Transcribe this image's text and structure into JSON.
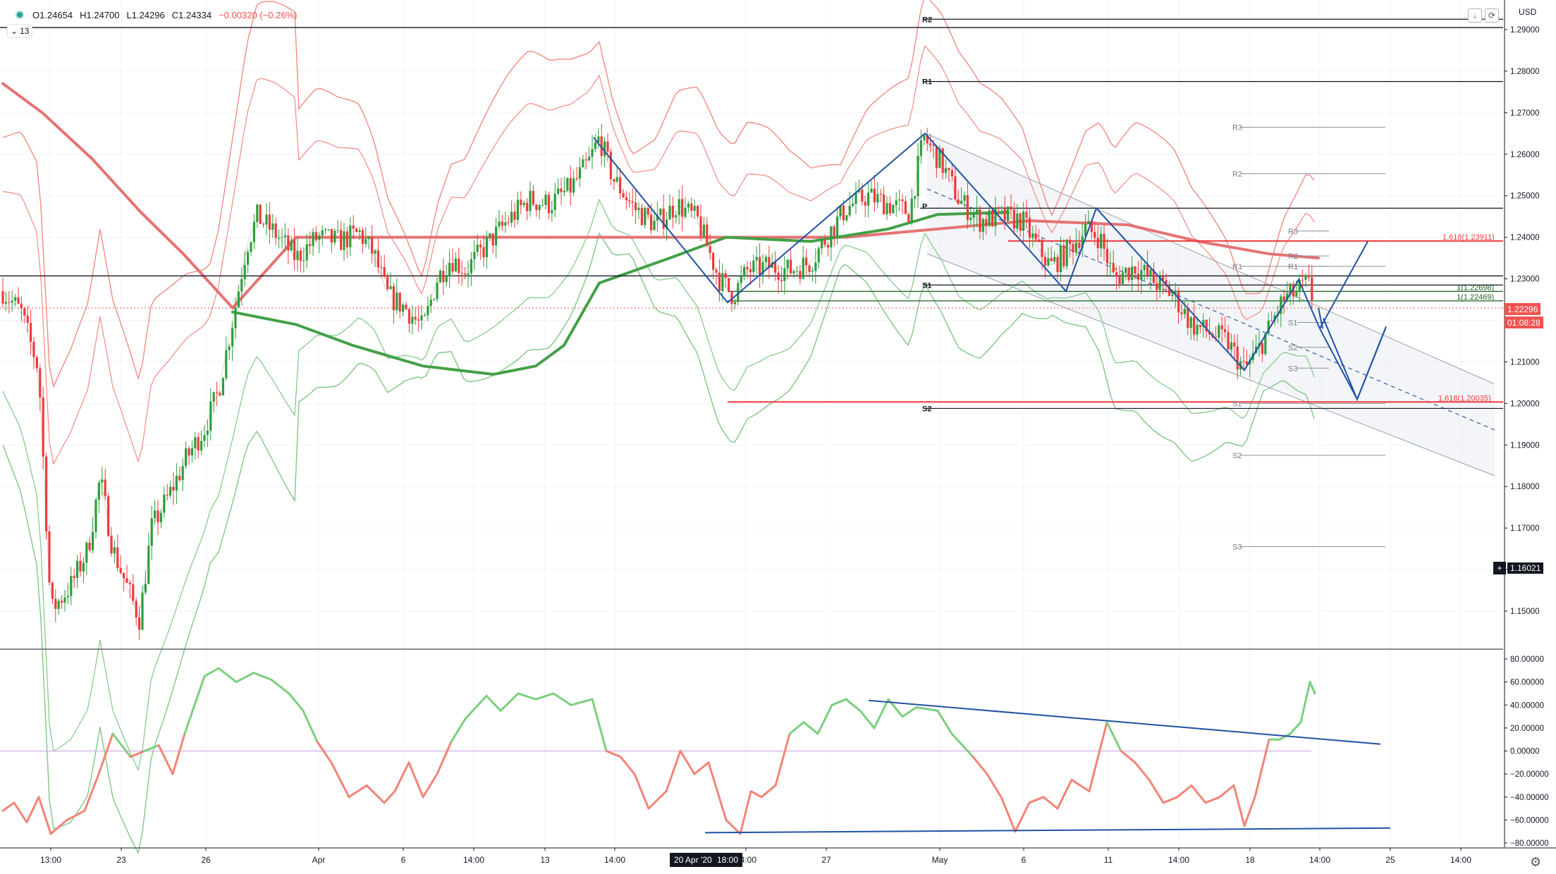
{
  "header": {
    "open": "O1.24654",
    "high": "H1.24700",
    "low": "L1.24296",
    "close": "C1.24334",
    "change": "−0.00320 (−0.26%)",
    "collapse_count": "13",
    "currency": "USD",
    "tool_icons": [
      "arrow-down-icon",
      "refresh-icon"
    ]
  },
  "colors": {
    "up": "#26a69a",
    "candle_up": "#2e9e3b",
    "candle_down": "#ef3b3b",
    "band_red": "#f28b82",
    "band_green": "#81c784",
    "ma_red": "#e57373",
    "ma_green": "#43a047",
    "trend_blue": "#2152a4",
    "current_price": "#ef5350"
  },
  "price_axis": {
    "ticks": [
      "1.29000",
      "1.28000",
      "1.27000",
      "1.26000",
      "1.25000",
      "1.24000",
      "1.23000",
      "1.22000",
      "1.21000",
      "1.20000",
      "1.19000",
      "1.18000",
      "1.17000",
      "1.16000",
      "1.15000"
    ],
    "current_price": "1.22296",
    "countdown": "01:08:28",
    "crosshair_price": "1.16021"
  },
  "osc_axis": {
    "ticks": [
      "80.00000",
      "60.00000",
      "40.00000",
      "20.00000",
      "0.00000",
      "−20.00000",
      "−40.00000",
      "−60.00000",
      "−80.00000"
    ]
  },
  "time_axis": {
    "labels": [
      "13:00",
      "23",
      "26",
      "Apr",
      "6",
      "14:00",
      "13",
      "14:00",
      "14:00",
      "27",
      "May",
      "6",
      "11",
      "14:00",
      "18",
      "14:00",
      "25",
      "14:00"
    ],
    "crosshair_date": "20 Apr '20",
    "crosshair_time": "18:00"
  },
  "pivots": {
    "large": [
      "R2",
      "R1",
      "P",
      "S1",
      "S2"
    ],
    "mid": [
      "R3",
      "R2",
      "R1",
      "S1",
      "S2",
      "S3"
    ],
    "small": [
      "R3",
      "R2",
      "R1",
      "S1",
      "S2",
      "S3"
    ]
  },
  "fib_labels": [
    "1.618(1.23911)",
    "1(1.22698)",
    "1(1.22469)",
    "1.618(1.20035)"
  ],
  "chart_data": {
    "type": "candlestick",
    "y_range": [
      1.143,
      1.2935
    ],
    "osc_range": [
      -85,
      85
    ],
    "price_levels": [
      {
        "label": "R2",
        "value": 1.2925
      },
      {
        "label": "R1",
        "value": 1.2775
      },
      {
        "label": "S1",
        "value": 1.2285
      },
      {
        "label": "S2",
        "value": 1.1988
      },
      {
        "label": "1.618(1.23911)",
        "value": 1.23911
      },
      {
        "label": "1(1.22698)",
        "value": 1.22698
      },
      {
        "label": "1(1.22469)",
        "value": 1.22469
      },
      {
        "label": "1.618(1.20035)",
        "value": 1.20035
      },
      {
        "label": "current",
        "value": 1.22296
      }
    ],
    "trend_extremes": [
      1.2243,
      1.264,
      1.2247,
      1.265,
      1.227,
      1.247,
      1.208,
      1.2298,
      1.218
    ]
  }
}
